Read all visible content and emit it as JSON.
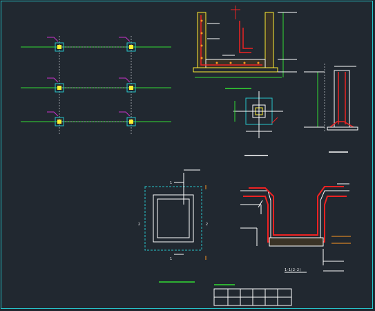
{
  "drawing": {
    "colors": {
      "background": "#212830",
      "frame": "#27c6cc",
      "grid": "#33dd33",
      "rebar": "#ee2222",
      "wall": "#ffee33",
      "outline": "#ffffff",
      "tag": "#cc33cc",
      "dim": "#ff9922"
    },
    "section_marks": {
      "top": "1",
      "bottom": "1",
      "left": "2",
      "right": "2"
    },
    "section_caption": "1-1(2-2)",
    "title_block": {
      "columns": 6,
      "rows": 2
    }
  }
}
